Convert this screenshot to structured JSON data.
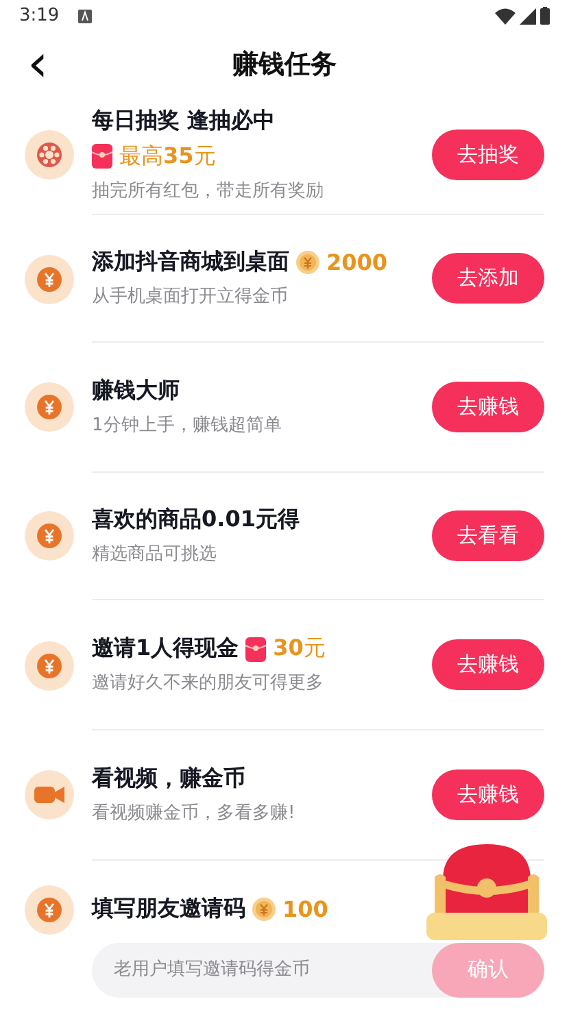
{
  "status_bar": {
    "time": "3:19"
  },
  "header": {
    "back_icon": "‹",
    "title": "赚钱任务"
  },
  "tasks": [
    {
      "kind": "draw",
      "title": "每日抽奖 逢抽必中",
      "reward": {
        "kind": "packet",
        "text": "最高**35**元"
      },
      "desc": "抽完所有红包，带走所有奖励",
      "button": "去抽奖"
    },
    {
      "kind": "coin",
      "title": "添加抖音商城到桌面",
      "reward": {
        "kind": "coin",
        "text": "2000"
      },
      "desc": "从手机桌面打开立得金币",
      "button": "去添加"
    },
    {
      "kind": "coin",
      "title": "赚钱大师",
      "desc": "1分钟上手，赚钱超简单",
      "button": "去赚钱"
    },
    {
      "kind": "coin",
      "title": "喜欢的商品0.01元得",
      "desc": "精选商品可挑选",
      "button": "去看看"
    },
    {
      "kind": "coin",
      "title": "邀请1人得现金",
      "reward": {
        "kind": "packet",
        "text": "**30**元"
      },
      "desc": "邀请好久不来的朋友可得更多",
      "button": "去赚钱"
    },
    {
      "kind": "video",
      "title": "看视频，赚金币",
      "desc": "看视频赚金币，多看多赚!",
      "button": "去赚钱"
    }
  ],
  "invite": {
    "kind": "coin",
    "title": "填写朋友邀请码",
    "reward": {
      "kind": "coin",
      "text": "100"
    },
    "placeholder": "老用户填写邀请码得金币",
    "button": "确认",
    "button_disabled": true
  }
}
